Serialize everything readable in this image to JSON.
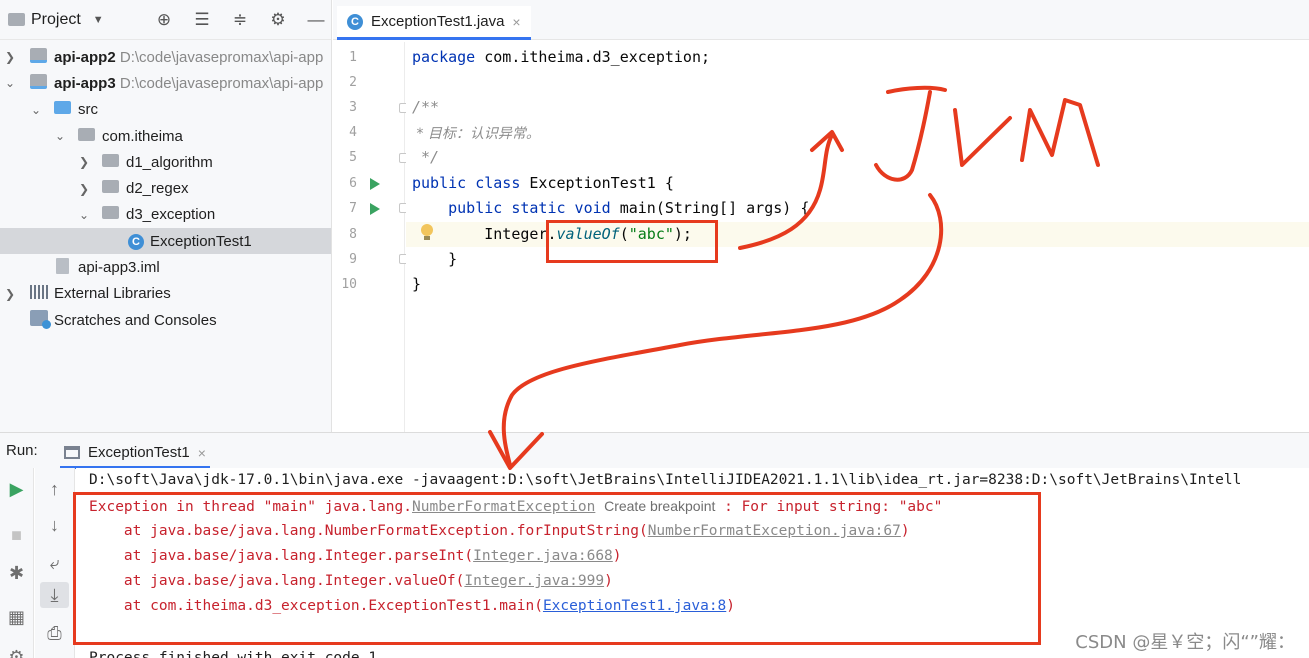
{
  "project_panel": {
    "title": "Project",
    "tree": [
      {
        "label": "api-app2",
        "path": "D:\\code\\javasepromax\\api-app",
        "bold": true
      },
      {
        "label": "api-app3",
        "path": "D:\\code\\javasepromax\\api-app",
        "bold": true
      },
      {
        "label": "src"
      },
      {
        "label": "com.itheima"
      },
      {
        "label": "d1_algorithm"
      },
      {
        "label": "d2_regex"
      },
      {
        "label": "d3_exception"
      },
      {
        "label": "ExceptionTest1"
      },
      {
        "label": "api-app3.iml"
      },
      {
        "label": "External Libraries"
      },
      {
        "label": "Scratches and Consoles"
      }
    ]
  },
  "editor": {
    "tab_label": "ExceptionTest1.java",
    "tab_close": "×",
    "line_numbers": [
      "1",
      "2",
      "3",
      "4",
      "5",
      "6",
      "7",
      "8",
      "9",
      "10"
    ],
    "lines": {
      "l1_kw": "package",
      "l1_rest": " com.itheima.d3_exception;",
      "l3": "/**",
      "l4": " * 目标：认识异常。",
      "l5": " */",
      "l6_kw": "public class",
      "l6_rest": " ExceptionTest1 {",
      "l7_indent": "    ",
      "l7_kw": "public static void",
      "l7_rest": " main(String[] args) {",
      "l8_pre": "        Integer.",
      "l8_method": "valueOf",
      "l8_open": "(",
      "l8_str": "\"abc\"",
      "l8_close": ");",
      "l9": "    }",
      "l10": "}"
    }
  },
  "run_panel": {
    "label": "Run:",
    "tab_label": "ExceptionTest1",
    "tab_close": "×",
    "console": {
      "cmd": "D:\\soft\\Java\\jdk-17.0.1\\bin\\java.exe -javaagent:D:\\soft\\JetBrains\\IntelliJIDEA2021.1.1\\lib\\idea_rt.jar=8238:D:\\soft\\JetBrains\\Intell",
      "exc_prefix": "Exception in thread \"main\" java.lang.",
      "exc_link": "NumberFormatException",
      "create_breakpoint": "Create breakpoint",
      "exc_suffix": " : For input string: \"abc\"",
      "st1_pre": "    at java.base/java.lang.NumberFormatException.forInputString(",
      "st1_link": "NumberFormatException.java:67",
      "st1_post": ")",
      "st2_pre": "    at java.base/java.lang.Integer.parseInt(",
      "st2_link": "Integer.java:668",
      "st2_post": ")",
      "st3_pre": "    at java.base/java.lang.Integer.valueOf(",
      "st3_link": "Integer.java:999",
      "st3_post": ")",
      "st4_pre": "    at com.itheima.d3_exception.ExceptionTest1.main(",
      "st4_link": "ExceptionTest1.java:8",
      "st4_post": ")",
      "finish": "Process finished with exit code 1"
    }
  },
  "annotation": {
    "handwriting": "JVM",
    "color": "#e63a1e"
  },
  "watermark": "CSDN @星￥空；闪“”耀：",
  "colors": {
    "keyword": "#0033b3",
    "string": "#067d17",
    "error": "#c7222d",
    "link": "#2a5fd8",
    "selection": "#d5d7db"
  }
}
